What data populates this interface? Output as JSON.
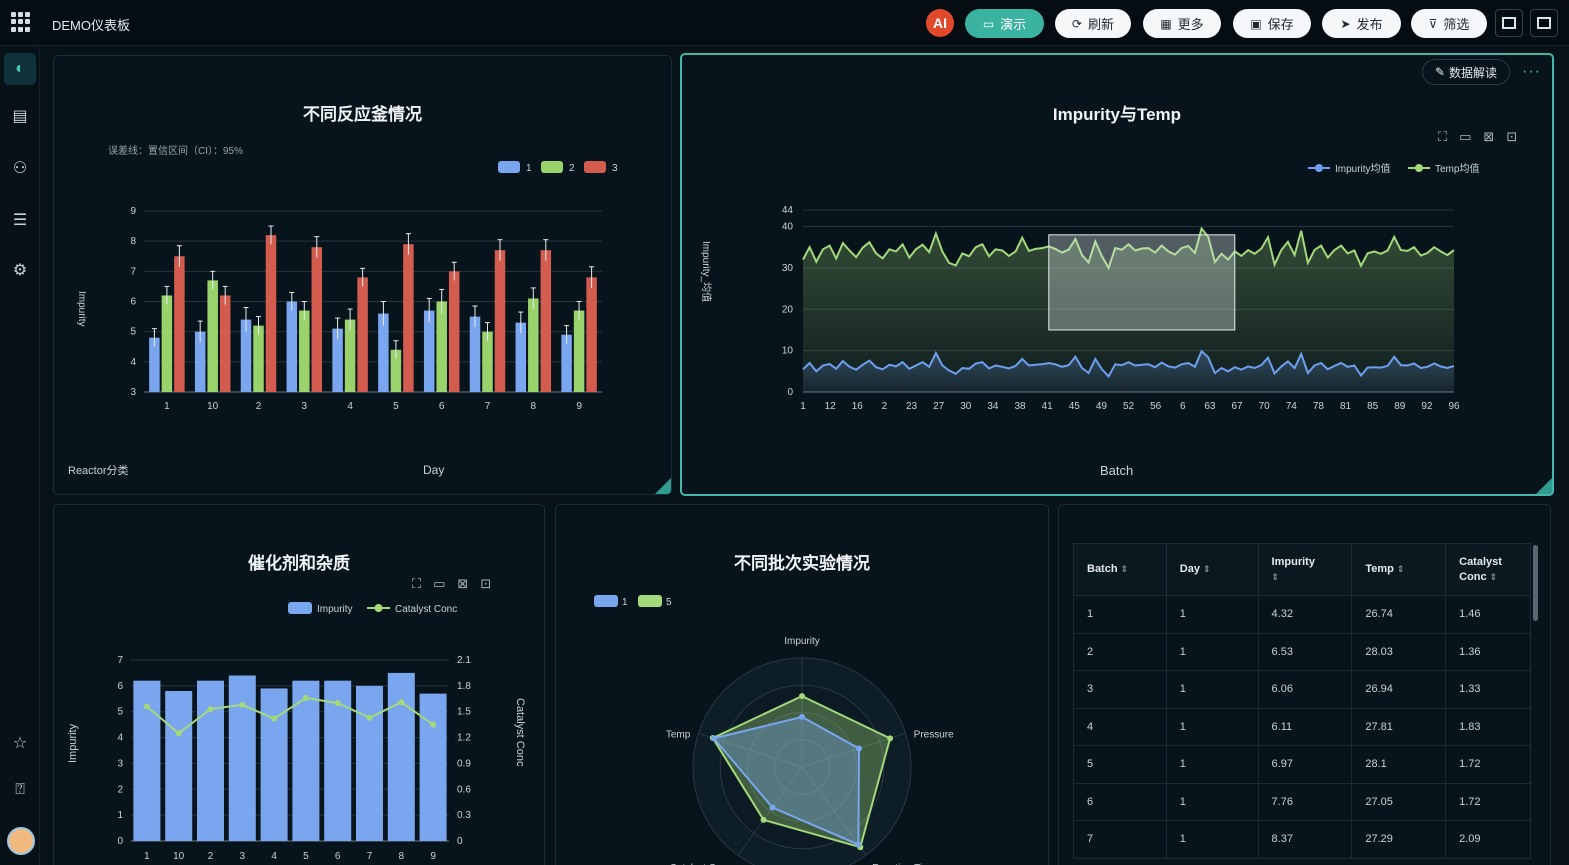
{
  "header": {
    "title": "DEMO仪表板",
    "ai_badge": "AI",
    "buttons": [
      {
        "key": "present",
        "label": "演示",
        "icon": "monitor-icon"
      },
      {
        "key": "refresh",
        "label": "刷新",
        "icon": "refresh-icon"
      },
      {
        "key": "more",
        "label": "更多",
        "icon": "grid-icon"
      },
      {
        "key": "save",
        "label": "保存",
        "icon": "save-icon"
      },
      {
        "key": "publish",
        "label": "发布",
        "icon": "send-icon"
      },
      {
        "key": "filter",
        "label": "筛选",
        "icon": "filter-icon"
      }
    ]
  },
  "sidebar": {
    "items": [
      "dashboard-icon",
      "folder-icon",
      "users-icon",
      "data-icon",
      "gear-icon",
      "star-icon",
      "help-icon"
    ]
  },
  "panel1": {
    "title": "不同反应釜情况",
    "note": "误差线：置信区间（CI）：95%",
    "ylabel": "Impurity",
    "xlabel": "Day",
    "group_label": "Reactor分类",
    "chart_data": {
      "type": "bar",
      "categories": [
        "1",
        "10",
        "2",
        "3",
        "4",
        "5",
        "6",
        "7",
        "8",
        "9"
      ],
      "ylim": [
        3,
        9
      ],
      "yticks": [
        "3",
        "4",
        "5",
        "6",
        "7",
        "8",
        "9"
      ],
      "legend_position": "top-right",
      "grid": true,
      "series": [
        {
          "name": "1",
          "color": "#7aa6f0",
          "values": [
            4.8,
            5.0,
            5.4,
            6.0,
            5.1,
            5.6,
            5.7,
            5.5,
            5.3,
            4.9
          ],
          "err": [
            0.3,
            0.35,
            0.4,
            0.3,
            0.35,
            0.4,
            0.4,
            0.35,
            0.35,
            0.3
          ]
        },
        {
          "name": "2",
          "color": "#9ad36b",
          "values": [
            6.2,
            6.7,
            5.2,
            5.7,
            5.4,
            4.4,
            6.0,
            5.0,
            6.1,
            5.7
          ],
          "err": [
            0.3,
            0.3,
            0.3,
            0.3,
            0.35,
            0.3,
            0.4,
            0.3,
            0.35,
            0.3
          ]
        },
        {
          "name": "3",
          "color": "#d35c4f",
          "values": [
            7.5,
            6.2,
            8.2,
            7.8,
            6.8,
            7.9,
            7.0,
            7.7,
            7.7,
            6.8
          ],
          "err": [
            0.35,
            0.3,
            0.3,
            0.35,
            0.3,
            0.35,
            0.3,
            0.35,
            0.35,
            0.35
          ]
        }
      ]
    }
  },
  "panel2": {
    "title": "Impurity与Temp",
    "ylabel": "Impurity_均值",
    "xlabel": "Batch",
    "interp_label": "数据解读",
    "chart_data": {
      "type": "line",
      "ylim": [
        0,
        44
      ],
      "yticks": [
        0,
        10,
        20,
        30,
        40,
        44
      ],
      "x_ticks": [
        "1",
        "12",
        "16",
        "2",
        "23",
        "27",
        "30",
        "34",
        "38",
        "41",
        "45",
        "49",
        "52",
        "56",
        "6",
        "63",
        "67",
        "70",
        "74",
        "78",
        "81",
        "85",
        "89",
        "92",
        "96"
      ],
      "legend_position": "top-right",
      "series": [
        {
          "name": "Impurity均值",
          "color": "#6f9ff0",
          "values": [
            5.5,
            7.0,
            5.0,
            6.4,
            6.8,
            5.6,
            7.5,
            6.1,
            5.4,
            6.6,
            7.6,
            6.0,
            5.5,
            6.6,
            6.2,
            7.2,
            5.6,
            6.4,
            7.2,
            6.1,
            9.4,
            6.4,
            5.2,
            4.4,
            5.8,
            5.6,
            6.9,
            7.2,
            5.7,
            6.4,
            6.1,
            5.7,
            6.3,
            8.0,
            6.4,
            6.6,
            6.7,
            7.0,
            6.7,
            6.1,
            6.5,
            8.5,
            5.8,
            4.6,
            8.0,
            5.5,
            3.8,
            6.7,
            6.5,
            7.2,
            6.4,
            6.6,
            6.7,
            6.0,
            7.1,
            6.2,
            5.9,
            6.7,
            7.0,
            6.1,
            9.9,
            8.4,
            4.6,
            5.8,
            5.0,
            6.0,
            5.4,
            6.2,
            5.8,
            6.5,
            8.3,
            4.5,
            6.2,
            7.4,
            5.8,
            9.2,
            4.6,
            6.4,
            7.0,
            5.5,
            6.3,
            7.0,
            6.1,
            6.4,
            4.0,
            5.9,
            6.0,
            5.9,
            6.3,
            8.5,
            6.5,
            6.4,
            6.9,
            5.8,
            6.1,
            6.9,
            6.2,
            5.8,
            6.3
          ]
        },
        {
          "name": "Temp均值",
          "color": "#a3d97a",
          "values": [
            32.0,
            35.0,
            31.5,
            34.5,
            35.4,
            32.3,
            36.0,
            34.2,
            32.6,
            34.9,
            36.2,
            33.5,
            32.3,
            34.5,
            34.0,
            35.7,
            32.5,
            34.5,
            35.6,
            33.8,
            38.3,
            33.9,
            31.2,
            30.6,
            33.5,
            32.8,
            35.0,
            35.7,
            32.8,
            34.5,
            34.2,
            32.9,
            34.0,
            37.3,
            34.1,
            34.6,
            34.8,
            35.2,
            34.6,
            33.7,
            34.4,
            37.0,
            33.1,
            31.3,
            36.4,
            32.8,
            30.0,
            34.8,
            34.4,
            35.7,
            34.2,
            34.7,
            34.8,
            33.7,
            35.4,
            34.0,
            33.2,
            34.8,
            35.3,
            33.6,
            39.5,
            37.5,
            31.4,
            33.4,
            32.0,
            34.0,
            32.9,
            34.3,
            33.4,
            34.7,
            37.4,
            30.8,
            34.3,
            36.3,
            33.1,
            39.0,
            31.2,
            34.3,
            35.4,
            32.5,
            34.3,
            35.4,
            33.5,
            34.2,
            30.5,
            33.5,
            34.0,
            33.4,
            34.2,
            37.5,
            34.3,
            34.1,
            35.0,
            33.0,
            33.6,
            35.0,
            34.0,
            33.1,
            34.3
          ]
        }
      ],
      "brush_selection": {
        "from": 37,
        "to": 65,
        "from_value": 15,
        "to_value": 38
      }
    }
  },
  "panel3": {
    "title": "催化剂和杂质",
    "ylabel": "Impurity",
    "ylabel_right": "Catalyst Conc",
    "chart_data": {
      "type": "bar",
      "categories": [
        "1",
        "10",
        "2",
        "3",
        "4",
        "5",
        "6",
        "7",
        "8",
        "9"
      ],
      "ylim": [
        0,
        7
      ],
      "ylim_right": [
        0,
        2.1
      ],
      "yticks": [
        "0",
        "1",
        "2",
        "3",
        "4",
        "5",
        "6",
        "7"
      ],
      "yticks_right": [
        "0",
        "0.3",
        "0.6",
        "0.9",
        "1.2",
        "1.5",
        "1.8",
        "2.1"
      ],
      "legend_position": "top-right",
      "series": [
        {
          "name": "Impurity",
          "color": "#7aa6f0",
          "type": "bar",
          "values": [
            6.2,
            5.8,
            6.2,
            6.4,
            5.9,
            6.2,
            6.2,
            6.0,
            6.5,
            5.7
          ]
        },
        {
          "name": "Catalyst Conc",
          "color": "#a3d97a",
          "type": "line",
          "axis": "right",
          "values": [
            1.56,
            1.25,
            1.53,
            1.58,
            1.42,
            1.66,
            1.6,
            1.43,
            1.61,
            1.35
          ]
        }
      ]
    }
  },
  "panel4": {
    "title": "不同批次实验情况",
    "chart_data": {
      "type": "radar",
      "indicators": [
        "Impurity",
        "Pressure",
        "Reaction Time",
        "Catalyst Conc",
        "Temp"
      ],
      "max": 1,
      "legend_position": "top-left",
      "series": [
        {
          "name": "1",
          "color": "#7aa6f0",
          "values": [
            0.46,
            0.55,
            0.88,
            0.46,
            0.85
          ]
        },
        {
          "name": "5",
          "color": "#a3d97a",
          "values": [
            0.65,
            0.85,
            0.91,
            0.6,
            0.86
          ]
        }
      ]
    }
  },
  "panel5": {
    "columns": [
      "Batch",
      "Day",
      "Impurity",
      "Temp",
      "Catalyst Conc"
    ],
    "rows": [
      [
        "1",
        "1",
        "4.32",
        "26.74",
        "1.46"
      ],
      [
        "2",
        "1",
        "6.53",
        "28.03",
        "1.36"
      ],
      [
        "3",
        "1",
        "6.06",
        "26.94",
        "1.33"
      ],
      [
        "4",
        "1",
        "6.11",
        "27.81",
        "1.83"
      ],
      [
        "5",
        "1",
        "6.97",
        "28.1",
        "1.72"
      ],
      [
        "6",
        "1",
        "7.76",
        "27.05",
        "1.72"
      ],
      [
        "7",
        "1",
        "8.37",
        "27.29",
        "2.09"
      ]
    ]
  }
}
